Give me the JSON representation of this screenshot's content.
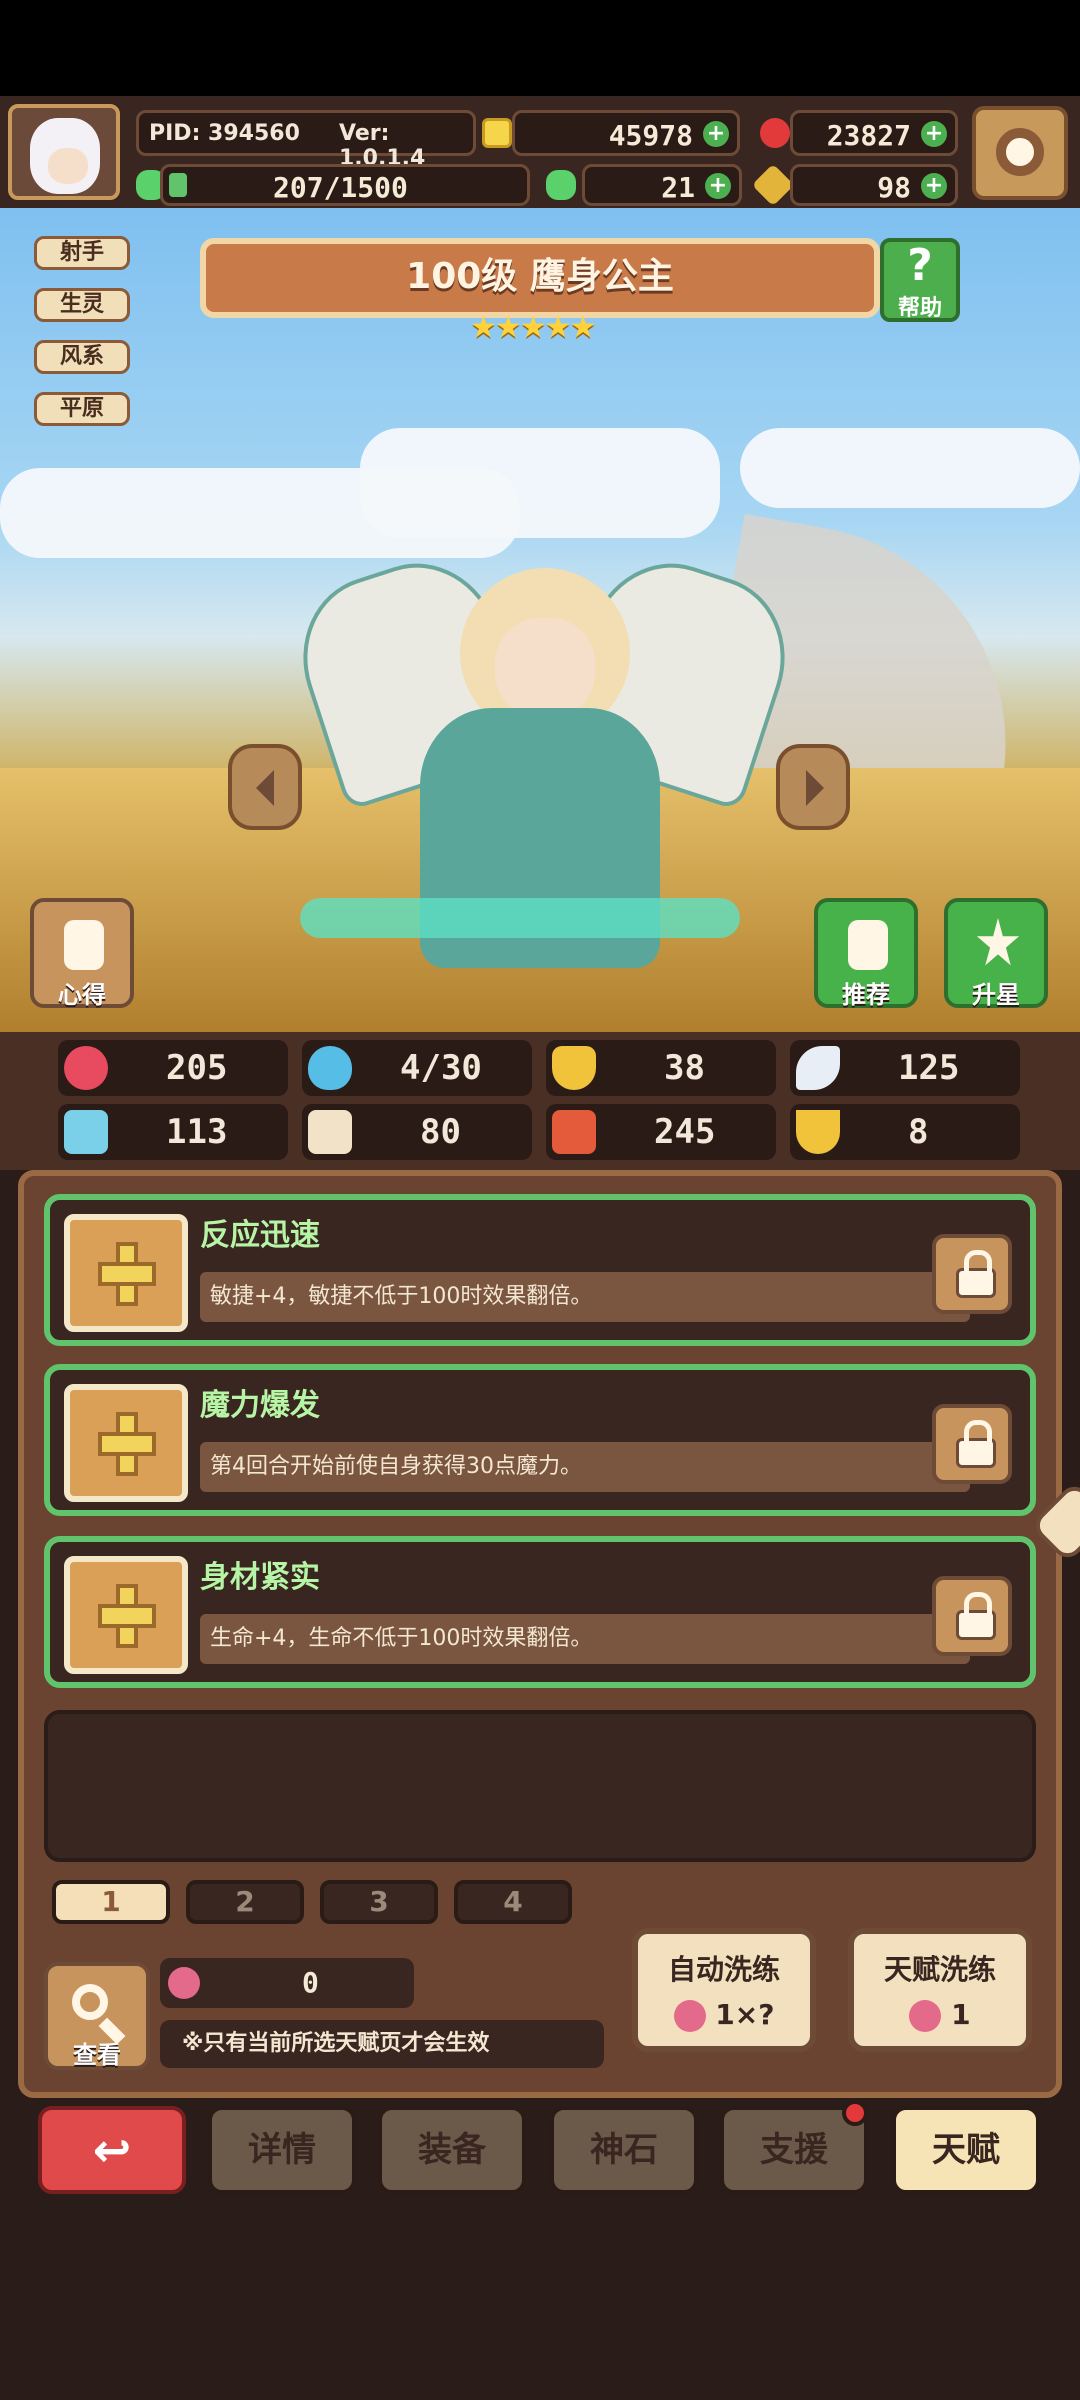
{
  "header": {
    "pid": "PID: 394560",
    "version": "Ver: 1.0.1.4",
    "coins": "45978",
    "gems": "23827",
    "exp": "207/1500",
    "clover": "21",
    "flask": "98"
  },
  "hero": {
    "tags": [
      "射手",
      "生灵",
      "风系",
      "平原"
    ],
    "title": "100级 鹰身公主",
    "stars": "★★★★★",
    "help_label": "帮助",
    "left_button_label": "心得",
    "recommend_label": "推荐",
    "upgrade_star_label": "升星"
  },
  "stats": [
    {
      "icon": "heart-icon",
      "value": "205"
    },
    {
      "icon": "drop-icon",
      "value": "4/30"
    },
    {
      "icon": "shield-icon",
      "value": "38"
    },
    {
      "icon": "wing-icon",
      "value": "125"
    },
    {
      "icon": "fist-icon",
      "value": "113"
    },
    {
      "icon": "book-icon",
      "value": "80"
    },
    {
      "icon": "boot-icon",
      "value": "245"
    },
    {
      "icon": "horseshoe-icon",
      "value": "8"
    }
  ],
  "talents": [
    {
      "name": "反应迅速",
      "desc": "敏捷+4，敏捷不低于100时效果翻倍。"
    },
    {
      "name": "魔力爆发",
      "desc": "第4回合开始前使自身获得30点魔力。"
    },
    {
      "name": "身材紧实",
      "desc": "生命+4，生命不低于100时效果翻倍。"
    }
  ],
  "pages": [
    "1",
    "2",
    "3",
    "4"
  ],
  "bottom": {
    "search_label": "查看",
    "fruit_count": "0",
    "note": "※只有当前所选天赋页才会生效",
    "auto_reroll_title": "自动洗练",
    "auto_reroll_cost": "1×?",
    "talent_reroll_title": "天赋洗练",
    "talent_reroll_cost": "1"
  },
  "nav": {
    "back_icon": "undo-arrow-icon",
    "items": [
      "详情",
      "装备",
      "神石",
      "支援",
      "天赋"
    ]
  },
  "colors": {
    "accent_green": "#61c46c",
    "brown_panel": "#6b4331"
  }
}
